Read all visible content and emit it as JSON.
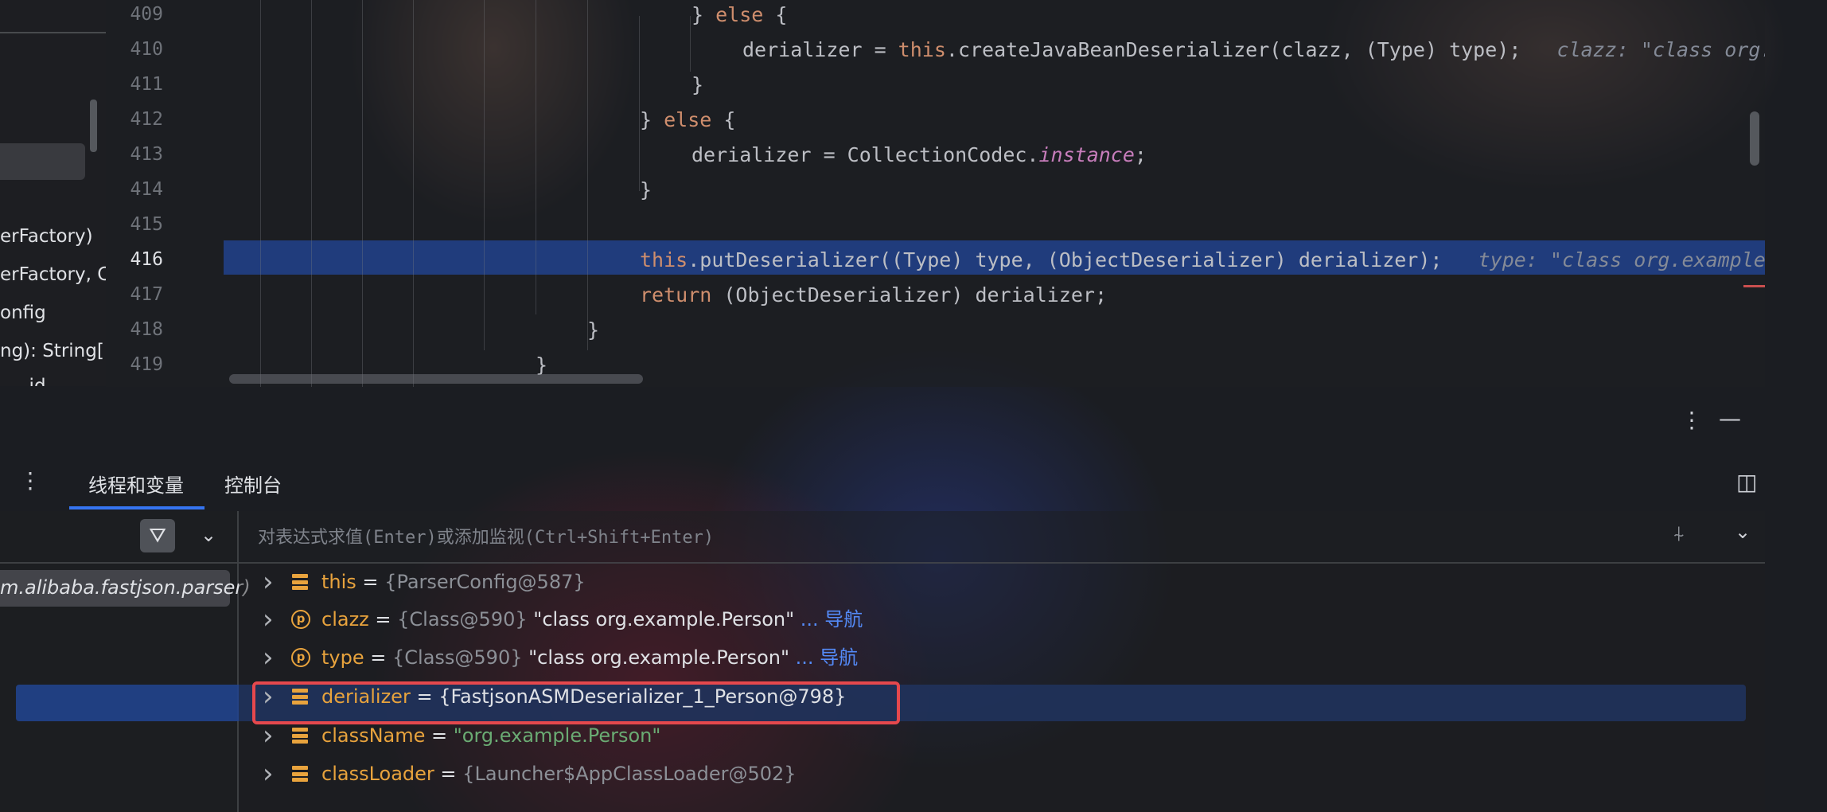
{
  "project_tree": {
    "items": [
      "erFactory)",
      "erFactory, Cl",
      "onfig",
      "ng): String[]",
      ", ...id"
    ]
  },
  "editor": {
    "lines": [
      {
        "num": "409",
        "tokens": [
          {
            "t": "} ",
            "c": ""
          },
          {
            "t": "else",
            "c": "kw"
          },
          {
            "t": " {",
            "c": ""
          }
        ]
      },
      {
        "num": "410",
        "tokens": [
          {
            "t": "derializer = ",
            "c": ""
          },
          {
            "t": "this",
            "c": "kw"
          },
          {
            "t": ".",
            "c": ""
          },
          {
            "t": "createJavaBeanDeserializer",
            "c": ""
          },
          {
            "t": "(clazz, (Type) type);",
            "c": ""
          },
          {
            "t": "   clazz: \"class org.exam",
            "c": "hint"
          }
        ]
      },
      {
        "num": "411",
        "tokens": [
          {
            "t": "}",
            "c": ""
          }
        ]
      },
      {
        "num": "412",
        "tokens": [
          {
            "t": "} ",
            "c": ""
          },
          {
            "t": "else",
            "c": "kw"
          },
          {
            "t": " {",
            "c": ""
          }
        ]
      },
      {
        "num": "413",
        "tokens": [
          {
            "t": "derializer = CollectionCodec.",
            "c": ""
          },
          {
            "t": "instance",
            "c": "it"
          },
          {
            "t": ";",
            "c": ""
          }
        ]
      },
      {
        "num": "414",
        "tokens": [
          {
            "t": "}",
            "c": ""
          }
        ]
      },
      {
        "num": "415",
        "tokens": []
      },
      {
        "num": "416",
        "tokens": [
          {
            "t": "this",
            "c": "kw"
          },
          {
            "t": ".putDeserializer((Type) type, (ObjectDeserializer) derializer);",
            "c": ""
          },
          {
            "t": "   type: \"class org.example.Per",
            "c": "hint"
          }
        ]
      },
      {
        "num": "417",
        "tokens": [
          {
            "t": "return",
            "c": "kw"
          },
          {
            "t": " (ObjectDeserializer) derializer;",
            "c": ""
          }
        ]
      },
      {
        "num": "418",
        "tokens": [
          {
            "t": "}",
            "c": ""
          }
        ]
      },
      {
        "num": "419",
        "tokens": [
          {
            "t": "}",
            "c": ""
          }
        ]
      }
    ]
  },
  "debug": {
    "tabs": [
      "线程和变量",
      "控制台"
    ],
    "eval_placeholder": "对表达式求值(Enter)或添加监视(Ctrl+Shift+Enter)",
    "frame": "m.alibaba.fastjson.parser)",
    "variables": [
      {
        "icon": "field",
        "name": "this",
        "type": "{ParserConfig@587}",
        "value": "",
        "value_style": "",
        "nav": ""
      },
      {
        "icon": "param",
        "name": "clazz",
        "type": "{Class@590}",
        "value": "\"class org.example.Person\"",
        "value_style": "vplain",
        "nav": "... 导航"
      },
      {
        "icon": "param",
        "name": "type",
        "type": "{Class@590}",
        "value": "\"class org.example.Person\"",
        "value_style": "vplain",
        "nav": "... 导航"
      },
      {
        "icon": "field",
        "name": "derializer",
        "type": "{FastjsonASMDeserializer_1_Person@798}",
        "value": "",
        "value_style": "vplain-type",
        "nav": ""
      },
      {
        "icon": "field",
        "name": "className",
        "type": "",
        "value": "\"org.example.Person\"",
        "value_style": "vstr",
        "nav": ""
      },
      {
        "icon": "field",
        "name": "classLoader",
        "type": "{Launcher$AppClassLoader@502}",
        "value": "",
        "value_style": "",
        "nav": ""
      }
    ]
  },
  "colors": {
    "selection": "#21428c",
    "accent": "#3574f0",
    "highlight_box": "#e5484d",
    "keyword": "#cf8e6d",
    "field_name": "#e8a33d"
  }
}
